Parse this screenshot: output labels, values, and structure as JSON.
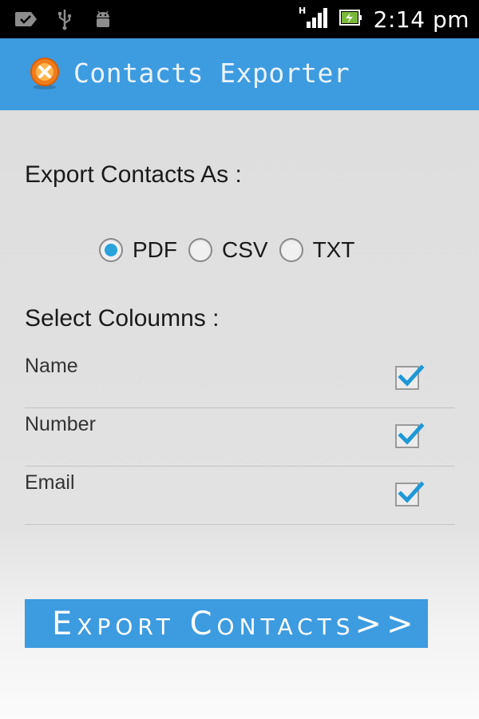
{
  "status_bar": {
    "time": "2:14 pm",
    "network_type": "H",
    "icons": [
      "message-check-icon",
      "usb-icon",
      "android-debug-icon",
      "signal-icon",
      "battery-charging-icon"
    ]
  },
  "app_bar": {
    "title": "Contacts Exporter",
    "logo_icon": "app-logo-icon"
  },
  "export_format": {
    "heading": "Export Contacts As :",
    "options": [
      {
        "label": "PDF",
        "selected": true
      },
      {
        "label": "CSV",
        "selected": false
      },
      {
        "label": "TXT",
        "selected": false
      }
    ]
  },
  "columns": {
    "heading": "Select Coloumns :",
    "items": [
      {
        "label": "Name",
        "checked": true
      },
      {
        "label": "Number",
        "checked": true
      },
      {
        "label": "Email",
        "checked": true
      }
    ]
  },
  "export_button": {
    "label": "Export Contacts>>"
  },
  "colors": {
    "accent": "#3d9be0",
    "radio_selected": "#2aa3dc",
    "checkmark": "#1e98d6"
  }
}
